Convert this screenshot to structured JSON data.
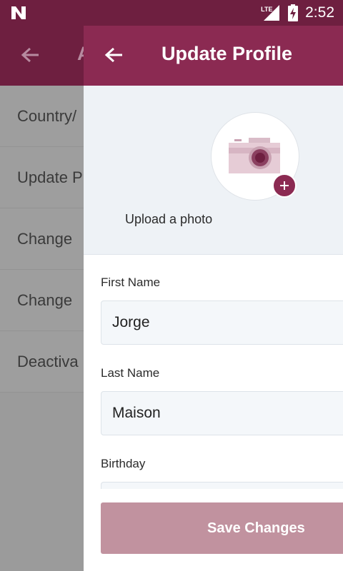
{
  "status_bar": {
    "network": "LTE",
    "time": "2:52"
  },
  "background_screen": {
    "title": "A",
    "items": [
      "Country/",
      "Update P",
      "Change",
      "Change",
      "Deactiva"
    ]
  },
  "header": {
    "title": "Update Profile"
  },
  "photo": {
    "upload_label": "Upload a photo"
  },
  "form": {
    "first_name_label": "First Name",
    "first_name_value": "Jorge",
    "last_name_label": "Last Name",
    "last_name_value": "Maison",
    "birthday_label": "Birthday"
  },
  "actions": {
    "save_label": "Save Changes"
  },
  "colors": {
    "status_bar": "#6e1f40",
    "app_bar": "#8b2a52",
    "save_button": "#c1929f",
    "photo_bg": "#eef2f6"
  },
  "icons": [
    "n-logo-icon",
    "lte-signal-icon",
    "battery-charging-icon",
    "back-arrow-icon",
    "camera-icon",
    "plus-icon"
  ]
}
